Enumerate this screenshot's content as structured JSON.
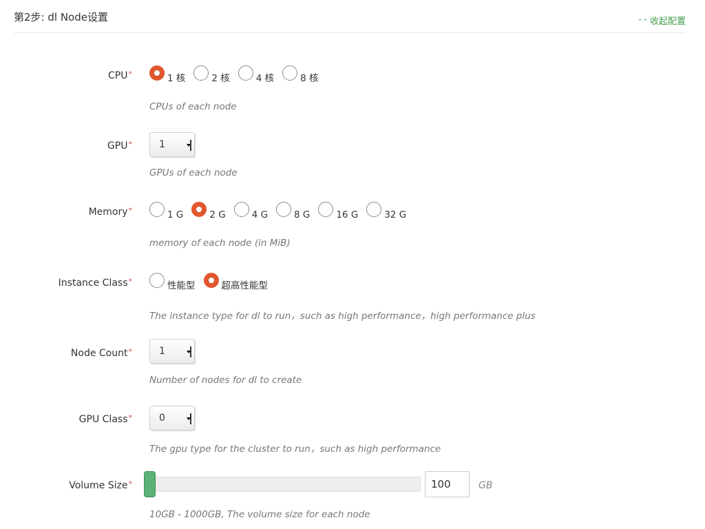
{
  "section": {
    "title": "第2步: dl Node设置",
    "collapse_icon": "double-chevron-up-icon",
    "collapse_label": "收起配置",
    "accent_color": "#3f9d4a"
  },
  "required_mark": "*",
  "cpu": {
    "label": "CPU",
    "options": [
      {
        "label": "1 核",
        "checked": true
      },
      {
        "label": "2 核",
        "checked": false
      },
      {
        "label": "4 核",
        "checked": false
      },
      {
        "label": "8 核",
        "checked": false
      }
    ],
    "help": "CPUs of each node"
  },
  "gpu": {
    "label": "GPU",
    "value": "1",
    "help": "GPUs of each node"
  },
  "memory": {
    "label": "Memory",
    "options": [
      {
        "label": "1 G",
        "checked": false
      },
      {
        "label": "2 G",
        "checked": true
      },
      {
        "label": "4 G",
        "checked": false
      },
      {
        "label": "8 G",
        "checked": false
      },
      {
        "label": "16 G",
        "checked": false
      },
      {
        "label": "32 G",
        "checked": false
      }
    ],
    "help": "memory of each node (in MiB)"
  },
  "instance_class": {
    "label": "Instance Class",
    "options": [
      {
        "label": "性能型",
        "checked": false
      },
      {
        "label": "超高性能型",
        "checked": true
      }
    ],
    "help": "The instance type for dl to run，such as high performance，high performance plus"
  },
  "node_count": {
    "label": "Node Count",
    "value": "1",
    "help": "Number of nodes for dl to create"
  },
  "gpu_class": {
    "label": "GPU Class",
    "value": "0",
    "help": "The gpu type for the cluster to run，such as high performance"
  },
  "volume_size": {
    "label": "Volume Size",
    "value": "100",
    "unit": "GB",
    "help": "10GB - 1000GB, The volume size for each node",
    "slider_color": "#5cb176"
  }
}
